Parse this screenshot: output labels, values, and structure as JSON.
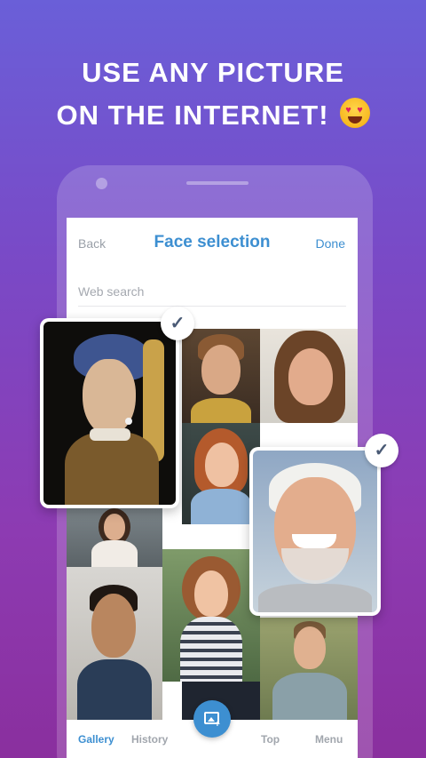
{
  "headline": {
    "line1": "USE ANY PICTURE",
    "line2": "ON THE INTERNET!"
  },
  "header": {
    "back_label": "Back",
    "title": "Face selection",
    "done_label": "Done"
  },
  "search": {
    "placeholder": "Web search"
  },
  "tabs": [
    {
      "label": "Gallery",
      "active": true
    },
    {
      "label": "History",
      "active": false
    },
    {
      "label": "Top",
      "active": false
    },
    {
      "label": "Menu",
      "active": false
    }
  ],
  "fab": {
    "icon": "add-photo-icon"
  },
  "selected": {
    "icon": "checkmark-icon",
    "glyph": "✓"
  },
  "colors": {
    "accent": "#3d8fd1",
    "muted": "#a1a6ad",
    "bg_top": "#6a5fd8",
    "bg_bottom": "#8a2f9e"
  }
}
